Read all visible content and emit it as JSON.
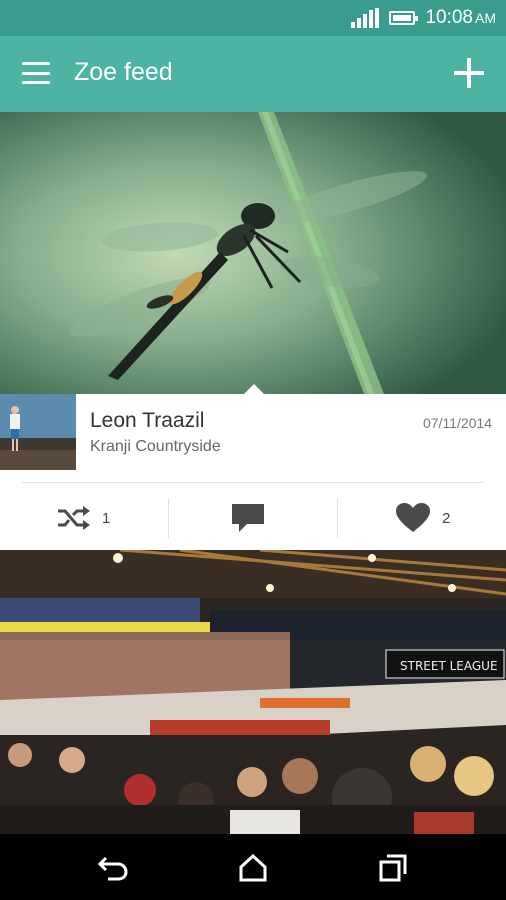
{
  "status_bar": {
    "time": "10:08",
    "ampm": "AM",
    "icons": [
      "signal-icon",
      "battery-icon"
    ]
  },
  "action_bar": {
    "title": "Zoe feed",
    "icons": [
      "menu-icon",
      "add-icon"
    ],
    "background": "#4db3a2"
  },
  "post": {
    "author": "Leon Traazil",
    "location": "Kranji Countryside",
    "date": "07/11/2014",
    "actions": {
      "remix_count": "1",
      "like_count": "2",
      "icons": [
        "shuffle-icon",
        "comment-icon",
        "heart-icon"
      ]
    }
  },
  "arena": {
    "banner_text": "STREET LEAGUE"
  },
  "nav_bar": {
    "icons": [
      "back-icon",
      "home-icon",
      "recents-icon"
    ]
  }
}
